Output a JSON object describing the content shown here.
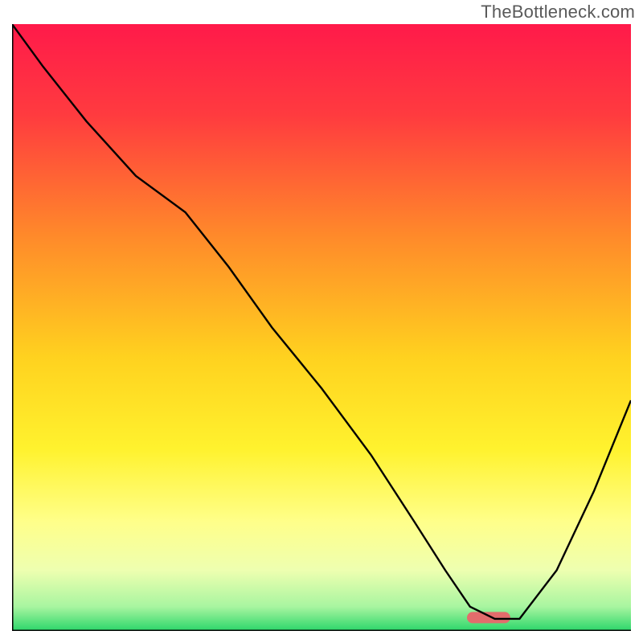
{
  "watermark": "TheBottleneck.com",
  "chart_data": {
    "type": "line",
    "title": "",
    "xlabel": "",
    "ylabel": "",
    "xlim": [
      0,
      100
    ],
    "ylim": [
      0,
      100
    ],
    "gradient_stops": [
      {
        "offset": 0,
        "color": "#ff1a4a"
      },
      {
        "offset": 15,
        "color": "#ff3b3f"
      },
      {
        "offset": 35,
        "color": "#ff8a2a"
      },
      {
        "offset": 55,
        "color": "#ffd21f"
      },
      {
        "offset": 70,
        "color": "#fff22e"
      },
      {
        "offset": 82,
        "color": "#ffff8a"
      },
      {
        "offset": 90,
        "color": "#eeffb0"
      },
      {
        "offset": 96,
        "color": "#a8f5a0"
      },
      {
        "offset": 100,
        "color": "#2bd66a"
      }
    ],
    "series": [
      {
        "name": "bottleneck-curve",
        "x": [
          0,
          5,
          12,
          20,
          28,
          35,
          42,
          50,
          58,
          65,
          70,
          74,
          78,
          82,
          88,
          94,
          100
        ],
        "y": [
          100,
          93,
          84,
          75,
          69,
          60,
          50,
          40,
          29,
          18,
          10,
          4,
          2,
          2,
          10,
          23,
          38
        ]
      }
    ],
    "marker": {
      "name": "highlight-bar",
      "x_center": 77,
      "width": 7,
      "y": 2.2,
      "color": "#e36c6c"
    },
    "border": {
      "left": true,
      "bottom": true,
      "right": false,
      "top": false,
      "color": "#000000",
      "width": 3
    }
  }
}
